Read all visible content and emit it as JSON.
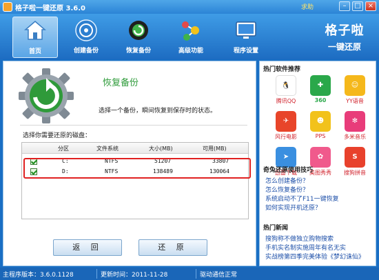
{
  "window": {
    "title": "格子啦一键还原 3.6.0",
    "help": "求助",
    "min_label": "–",
    "max_label": "□",
    "close_label": "×"
  },
  "toolbar": {
    "items": [
      {
        "label": "首页",
        "icon": "home-icon"
      },
      {
        "label": "创建备份",
        "icon": "backup-disc-icon"
      },
      {
        "label": "恢复备份",
        "icon": "restore-gear-icon"
      },
      {
        "label": "高级功能",
        "icon": "advanced-molecule-icon"
      },
      {
        "label": "程序设置",
        "icon": "settings-monitor-icon"
      }
    ],
    "active_index": 0,
    "brand_line1": "格子啦",
    "brand_line2": "一键还原"
  },
  "main": {
    "title": "恢复备份",
    "description": "选择一个备份，瞬间恢复到保存时的状态。",
    "select_label": "选择你需要还原的磁盘：",
    "columns": [
      "分区",
      "文件系统",
      "大小(MB)",
      "可用(MB)"
    ],
    "rows": [
      {
        "checked": true,
        "partition": "C:",
        "filesystem": "NTFS",
        "size": "51207",
        "free": "33807"
      },
      {
        "checked": true,
        "partition": "D:",
        "filesystem": "NTFS",
        "size": "138489",
        "free": "130064"
      }
    ],
    "back_button": "返 回",
    "restore_button": "还 原"
  },
  "side": {
    "hot_software_title": "热门软件推荐",
    "apps": [
      {
        "name": "腾讯QQ",
        "icon": "qq-penguin-icon",
        "color": "#ffffff",
        "fg": "#111111"
      },
      {
        "name": "360",
        "icon": "360-safe-icon",
        "color": "#2aa84a",
        "fg": "#ffffff"
      },
      {
        "name": "YY语音",
        "icon": "yy-bear-icon",
        "color": "#f5b81b",
        "fg": "#ffffff"
      },
      {
        "name": "风行电影",
        "icon": "funshion-icon",
        "color": "#e8452a",
        "fg": "#ffffff"
      },
      {
        "name": "PPS",
        "icon": "pps-icon",
        "color": "#f2c21b",
        "fg": "#ffffff"
      },
      {
        "name": "多米音乐",
        "icon": "duomi-music-icon",
        "color": "#e83c7a",
        "fg": "#ffffff"
      },
      {
        "name": "迅雷下载",
        "icon": "xunlei-bird-icon",
        "color": "#3a8fe0",
        "fg": "#ffffff"
      },
      {
        "name": "美图秀秀",
        "icon": "meitu-icon",
        "color": "#f05a8c",
        "fg": "#ffffff"
      },
      {
        "name": "搜狗拼音",
        "icon": "sogou-pinyin-icon",
        "color": "#e8412c",
        "fg": "#ffffff"
      }
    ],
    "tips_title": "奇兔还原使用技巧",
    "tips": [
      "怎么创建备份？",
      "怎么恢复备份？",
      "系统启动不了F11一键恢复",
      "如何实现开机还原？"
    ],
    "news_title": "热门新闻",
    "news": [
      "搜狗称不做独立购物搜索",
      "手机实名制实施周年有名无实",
      "实战榜第四季完美体验《梦幻诛仙》"
    ]
  },
  "status": {
    "version": "主程序版本：3.6.0.1128",
    "updated": "更新时间：2011-11-28",
    "driver": "驱动通信正常"
  }
}
